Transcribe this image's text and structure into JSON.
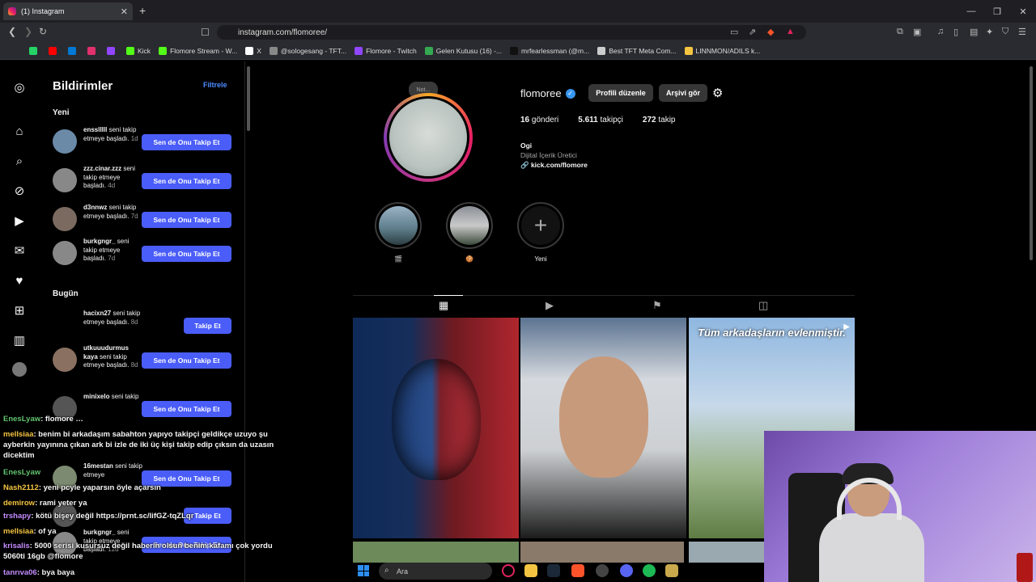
{
  "browser": {
    "tab_title": "(1) Instagram",
    "tab_close": "✕",
    "new_tab": "+",
    "win_min": "—",
    "win_restore": "❐",
    "win_close": "✕",
    "url": "instagram.com/flomoree/",
    "bookmarks": [
      {
        "label": "",
        "color": "#25d366"
      },
      {
        "label": "",
        "color": "#ff0000"
      },
      {
        "label": "",
        "color": "#0078d4"
      },
      {
        "label": "",
        "color": "#e1306c"
      },
      {
        "label": "",
        "color": "#9146ff"
      },
      {
        "label": "Kick",
        "color": "#53fc18"
      },
      {
        "label": "Flomore Stream - W...",
        "color": "#53fc18"
      },
      {
        "label": "X",
        "color": "#ffffff"
      },
      {
        "label": "@sologesang - TFT...",
        "color": "#888888"
      },
      {
        "label": "Flomore - Twitch",
        "color": "#9146ff"
      },
      {
        "label": "Gelen Kutusu (16) -...",
        "color": "#34a853"
      },
      {
        "label": "mrfearlessman (@m...",
        "color": "#111111"
      },
      {
        "label": "Best TFT Meta Com...",
        "color": "#cccccc"
      },
      {
        "label": "LINNMON/ADILS k...",
        "color": "#f5c542"
      }
    ]
  },
  "notifications": {
    "title": "Bildirimler",
    "filter": "Filtrele",
    "section_new": "Yeni",
    "section_today": "Bugün",
    "items": [
      {
        "user": "ensslllll",
        "text": "seni takip etmeye başladı.",
        "time": "1d",
        "button": "Sen de Onu Takip Et"
      },
      {
        "user": "zzz.cinar.zzz",
        "text": "seni takip etmeye başladı.",
        "time": "4d",
        "button": "Sen de Onu Takip Et"
      },
      {
        "user": "d3nnwz",
        "text": "seni takip etmeye başladı.",
        "time": "7d",
        "button": "Sen de Onu Takip Et"
      },
      {
        "user": "burkgngr_",
        "text": "seni takip etmeye başladı.",
        "time": "7d",
        "button": "Sen de Onu Takip Et"
      },
      {
        "user": "hacixn27",
        "text": "seni takip etmeye başladı.",
        "time": "8d",
        "button": "Takip Et"
      },
      {
        "user": "utkuuudurmus kaya",
        "text": "seni takip etmeye başladı.",
        "time": "8d",
        "button": "Sen de Onu Takip Et"
      },
      {
        "user": "minixelo",
        "text": "seni takip",
        "time": "",
        "button": "Sen de Onu Takip Et"
      },
      {
        "user": "16mestan",
        "text": "seni takip etmeye",
        "time": "",
        "button": "Sen de Onu Takip Et"
      },
      {
        "user": "",
        "text": "",
        "time": "",
        "button": "Takip Et"
      },
      {
        "user": "burkgngr_",
        "text": "seni takip etmeye başladı.",
        "time": "12d",
        "button": "Sen de Onu Takip Et"
      }
    ]
  },
  "profile": {
    "note": "Not...",
    "username": "flomoree",
    "edit_button": "Profili düzenle",
    "archive_button": "Arşivi gör",
    "posts_count": "16",
    "posts_label": "gönderi",
    "followers_count": "5.611",
    "followers_label": "takipçi",
    "following_count": "272",
    "following_label": "takip",
    "name": "Ogi",
    "category": "Dijital İçerik Üretici",
    "link": "kick.com/flomore",
    "highlights": [
      {
        "label": "🎬"
      },
      {
        "label": "🍪"
      },
      {
        "label": "Yeni"
      }
    ],
    "post_caption": "Tüm arkadaşların evlenmiştir."
  },
  "chat": [
    {
      "user": "EnesLyaw",
      "text": ": flomore …",
      "color": "g"
    },
    {
      "user": "mellsiaa",
      "text": ": benim bi arkadaşım sabahton yapıyo takipçi geldikçe uzuyo şu ayberkin yayınına çıkan ark bi izle de iki üç kişi takip edip çıksın da uzasın dicektim",
      "color": "y"
    },
    {
      "user": "EnesLyaw",
      "text": "",
      "color": "g"
    },
    {
      "user": "Nash2112",
      "text": ": yeni pcyle yaparsın öyle açarsın",
      "color": "y"
    },
    {
      "user": "demirow",
      "text": ": rami yeter ya",
      "color": "y"
    },
    {
      "user": "trshapy",
      "text": ": kötü bişey değil https://prnt.sc/lifGZ-tqZLqr",
      "color": "p"
    },
    {
      "user": "mellsiaa",
      "text": ": of ya",
      "color": "y"
    },
    {
      "user": "krisalis",
      "text": ": 5000 serisi kusursuz değil haberin olsun benim kafamı çok yordu 5060ti 16gb @flomore",
      "color": "p"
    },
    {
      "user": "tanrıva06",
      "text": ": bya baya",
      "color": "p"
    }
  ],
  "taskbar": {
    "search_placeholder": "Ara"
  }
}
